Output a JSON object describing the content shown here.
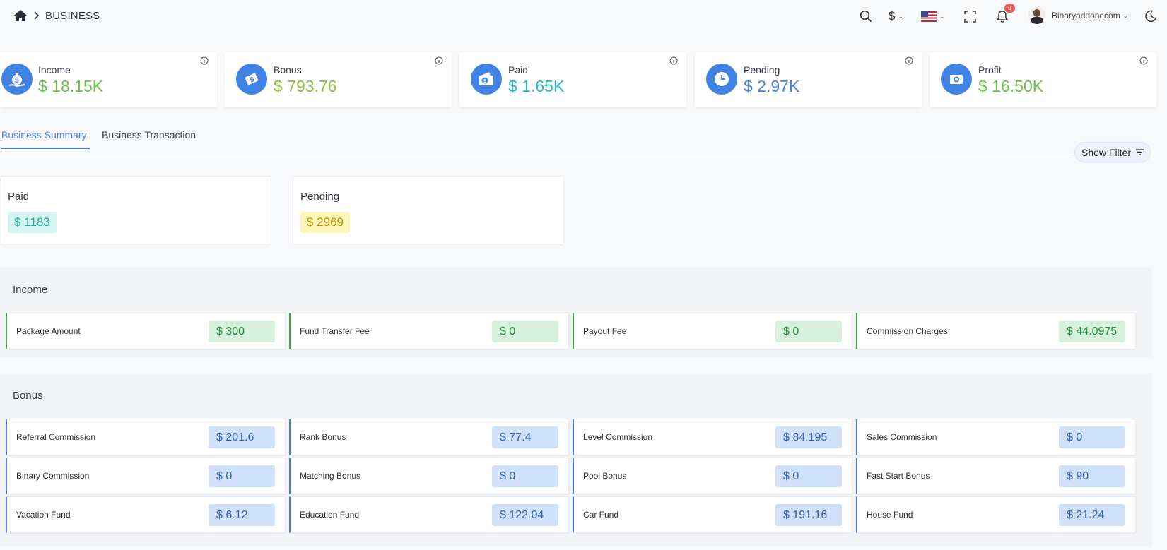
{
  "breadcrumb": {
    "current": "BUSINESS"
  },
  "topbar": {
    "currency_symbol": "$",
    "notification_count": "0",
    "username": "Binaryaddonecom"
  },
  "stats": [
    {
      "label": "Income",
      "value": "$ 18.15K",
      "color": "#6cc04a",
      "icon": "money-bag-icon"
    },
    {
      "label": "Bonus",
      "value": "$ 793.76",
      "color": "#8bbf3f",
      "icon": "cash-bill-icon"
    },
    {
      "label": "Paid",
      "value": "$ 1.65K",
      "color": "#27b8c7",
      "icon": "wallet-icon"
    },
    {
      "label": "Pending",
      "value": "$ 2.97K",
      "color": "#4a84d6",
      "icon": "clock-icon"
    },
    {
      "label": "Profit",
      "value": "$ 16.50K",
      "color": "#6cc04a",
      "icon": "money-icon"
    }
  ],
  "tabs": [
    {
      "label": "Business Summary",
      "active": true
    },
    {
      "label": "Business Transaction",
      "active": false
    }
  ],
  "filter_button": {
    "label": "Show Filter"
  },
  "summary": {
    "paid": {
      "label": "Paid",
      "value": "$ 1183",
      "bg": "#d5f5f3",
      "color": "#24a89a"
    },
    "pending": {
      "label": "Pending",
      "value": "$ 2969",
      "bg": "#fdf6b8",
      "color": "#b39400"
    }
  },
  "income": {
    "title": "Income",
    "items": [
      {
        "label": "Package Amount",
        "value": "$ 300"
      },
      {
        "label": "Fund Transfer Fee",
        "value": "$ 0"
      },
      {
        "label": "Payout Fee",
        "value": "$ 0"
      },
      {
        "label": "Commission Charges",
        "value": "$ 44.0975"
      }
    ]
  },
  "bonus": {
    "title": "Bonus",
    "items": [
      {
        "label": "Referral Commission",
        "value": "$ 201.6"
      },
      {
        "label": "Rank Bonus",
        "value": "$ 77.4"
      },
      {
        "label": "Level Commission",
        "value": "$ 84.195"
      },
      {
        "label": "Sales Commission",
        "value": "$ 0"
      },
      {
        "label": "Binary Commission",
        "value": "$ 0"
      },
      {
        "label": "Matching Bonus",
        "value": "$ 0"
      },
      {
        "label": "Pool Bonus",
        "value": "$ 0"
      },
      {
        "label": "Fast Start Bonus",
        "value": "$ 90"
      },
      {
        "label": "Vacation Fund",
        "value": "$ 6.12"
      },
      {
        "label": "Education Fund",
        "value": "$ 122.04"
      },
      {
        "label": "Car Fund",
        "value": "$ 191.16"
      },
      {
        "label": "House Fund",
        "value": "$ 21.24"
      }
    ]
  }
}
